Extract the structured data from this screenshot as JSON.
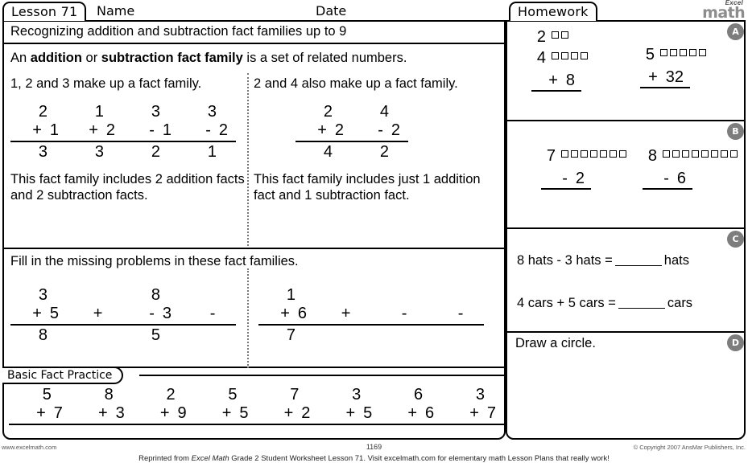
{
  "header": {
    "lesson_tab": "Lesson  71",
    "name_label": "Name",
    "date_label": "Date",
    "homework_tab": "Homework",
    "logo_top": "Excel",
    "logo_bottom": "math"
  },
  "objective": "Recognizing addition and subtraction fact families up to 9",
  "lesson": {
    "intro_pre": "An ",
    "intro_bold1": "addition",
    "intro_mid": " or ",
    "intro_bold2": "subtraction fact family",
    "intro_post": " is a set of related numbers.",
    "left": {
      "heading": "1, 2 and 3 make up a fact family.",
      "problems": [
        {
          "top": "2",
          "op": "+",
          "operand": "1",
          "answer": "3"
        },
        {
          "top": "1",
          "op": "+",
          "operand": "2",
          "answer": "3"
        },
        {
          "top": "3",
          "op": "-",
          "operand": "1",
          "answer": "2"
        },
        {
          "top": "3",
          "op": "-",
          "operand": "2",
          "answer": "1"
        }
      ],
      "footer": "This fact family includes 2 addition facts and 2 subtraction facts."
    },
    "right": {
      "heading": "2 and 4 also make up a fact family.",
      "problems": [
        {
          "top": "2",
          "op": "+",
          "operand": "2",
          "answer": "4"
        },
        {
          "top": "4",
          "op": "-",
          "operand": "2",
          "answer": "2"
        }
      ],
      "footer": "This fact family includes just 1 addition fact and 1 subtraction fact."
    }
  },
  "fillin": {
    "title": "Fill in the missing problems in these fact families.",
    "left": [
      {
        "top": "3",
        "op": "+",
        "operand": "5",
        "answer": "8"
      },
      {
        "top": "",
        "op": "+",
        "operand": "",
        "answer": ""
      },
      {
        "top": "8",
        "op": "-",
        "operand": "3",
        "answer": "5"
      },
      {
        "top": "",
        "op": "-",
        "operand": "",
        "answer": ""
      }
    ],
    "right": [
      {
        "top": "1",
        "op": "+",
        "operand": "6",
        "answer": "7"
      },
      {
        "top": "",
        "op": "+",
        "operand": "",
        "answer": ""
      },
      {
        "top": "",
        "op": "-",
        "operand": "",
        "answer": ""
      },
      {
        "top": "",
        "op": "-",
        "operand": "",
        "answer": ""
      }
    ]
  },
  "basic_fact_practice": {
    "tab_label": "Basic Fact Practice",
    "problems": [
      {
        "top": "5",
        "op": "+",
        "operand": "7"
      },
      {
        "top": "8",
        "op": "+",
        "operand": "3"
      },
      {
        "top": "2",
        "op": "+",
        "operand": "9"
      },
      {
        "top": "5",
        "op": "+",
        "operand": "5"
      },
      {
        "top": "7",
        "op": "+",
        "operand": "2"
      },
      {
        "top": "3",
        "op": "+",
        "operand": "5"
      },
      {
        "top": "6",
        "op": "+",
        "operand": "6"
      },
      {
        "top": "3",
        "op": "+",
        "operand": "7"
      }
    ]
  },
  "homework": {
    "a": {
      "badge": "A",
      "problems": [
        {
          "top": "2",
          "top_squares": 2,
          "mid": "4",
          "mid_squares": 4,
          "op": "+",
          "operand": "8"
        },
        {
          "top": "5",
          "top_squares": 5,
          "mid": "",
          "mid_squares": 0,
          "op": "+",
          "operand": "32"
        }
      ]
    },
    "b": {
      "badge": "B",
      "problems": [
        {
          "top": "7",
          "top_squares": 7,
          "op": "-",
          "operand": "2"
        },
        {
          "top": "8",
          "top_squares": 8,
          "op": "-",
          "operand": "6"
        }
      ]
    },
    "c": {
      "badge": "C",
      "lines": [
        {
          "pre": "8 hats - 3 hats =",
          "post": "hats"
        },
        {
          "pre": "4 cars + 5 cars =",
          "post": "cars"
        }
      ]
    },
    "d": {
      "badge": "D",
      "prompt": "Draw a circle."
    }
  },
  "footer": {
    "left": "www.excelmath.com",
    "page": "1169",
    "right": "© Copyright 2007 AnsMar Publishers, Inc.",
    "note_pre": "Reprinted from ",
    "note_italic": "Excel Math",
    "note_post": " Grade 2 Student Worksheet Lesson 71. Visit excelmath.com for elementary math Lesson Plans that really work!"
  }
}
